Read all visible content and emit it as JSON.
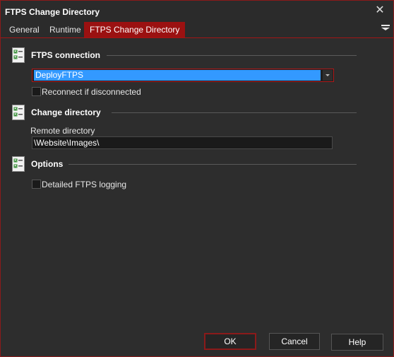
{
  "window": {
    "title": "FTPS Change Directory",
    "close_label": "✕",
    "accent_color": "#9b1111"
  },
  "tabs": [
    {
      "label": "General",
      "active": false
    },
    {
      "label": "Runtime",
      "active": false
    },
    {
      "label": "FTPS Change Directory",
      "active": true
    }
  ],
  "sections": {
    "connection": {
      "title": "FTPS connection",
      "icon": "checklist-icon",
      "combo_value": "DeployFTPS",
      "reconnect_label": "Reconnect if disconnected",
      "reconnect_checked": false
    },
    "change_directory": {
      "title": "Change directory",
      "icon": "checklist-icon",
      "remote_label": "Remote directory",
      "remote_value": "\\Website\\Images\\"
    },
    "options": {
      "title": "Options",
      "icon": "checklist-icon",
      "logging_label": "Detailed FTPS logging",
      "logging_checked": false
    }
  },
  "footer": {
    "ok_label": "OK",
    "cancel_label": "Cancel",
    "help_label": "Help"
  }
}
